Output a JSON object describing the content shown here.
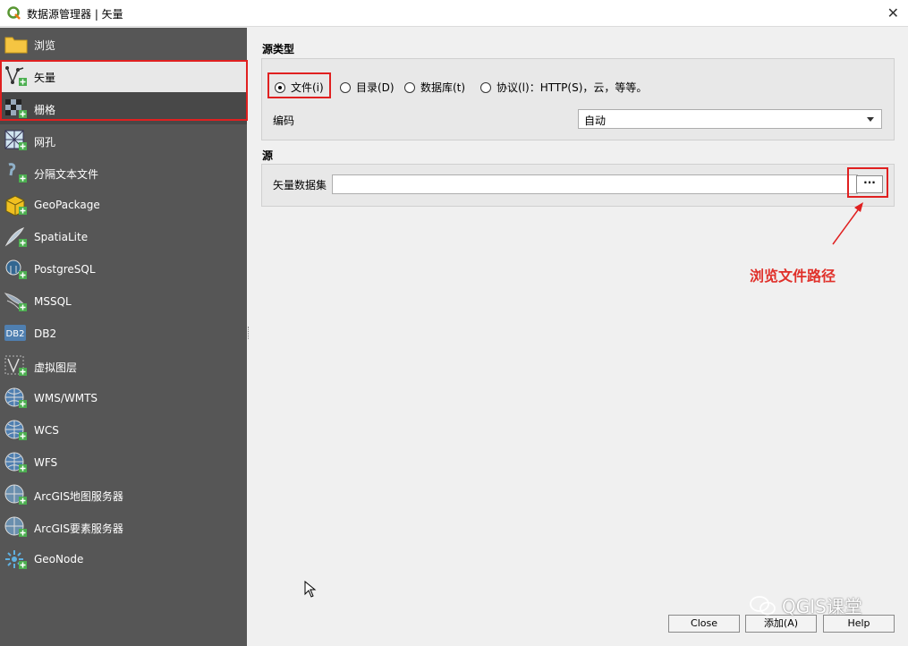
{
  "window": {
    "title": "数据源管理器 | 矢量"
  },
  "sidebar": {
    "items": [
      {
        "label": "浏览",
        "icon": "folder-icon"
      },
      {
        "label": "矢量",
        "icon": "vector-layer-icon"
      },
      {
        "label": "栅格",
        "icon": "raster-layer-icon"
      },
      {
        "label": "网孔",
        "icon": "mesh-layer-icon"
      },
      {
        "label": "分隔文本文件",
        "icon": "delimited-text-icon"
      },
      {
        "label": "GeoPackage",
        "icon": "geopackage-icon"
      },
      {
        "label": "SpatiaLite",
        "icon": "spatialite-icon"
      },
      {
        "label": "PostgreSQL",
        "icon": "postgresql-icon"
      },
      {
        "label": "MSSQL",
        "icon": "mssql-icon"
      },
      {
        "label": "DB2",
        "icon": "db2-icon"
      },
      {
        "label": "虚拟图层",
        "icon": "virtual-layer-icon"
      },
      {
        "label": "WMS/WMTS",
        "icon": "wms-globe-icon"
      },
      {
        "label": "WCS",
        "icon": "wcs-globe-icon"
      },
      {
        "label": "WFS",
        "icon": "wfs-globe-icon"
      },
      {
        "label": "ArcGIS地图服务器",
        "icon": "arcgis-map-server-icon"
      },
      {
        "label": "ArcGIS要素服务器",
        "icon": "arcgis-feature-server-icon"
      },
      {
        "label": "GeoNode",
        "icon": "geonode-icon"
      }
    ],
    "db2_icon_text": "DB2"
  },
  "source_type": {
    "title": "源类型",
    "options": [
      {
        "label": "文件(i)",
        "checked": true
      },
      {
        "label": "目录(D)",
        "checked": false
      },
      {
        "label": "数据库(t)",
        "checked": false
      },
      {
        "label": "协议(l)：HTTP(S)，云，等等。",
        "checked": false
      }
    ],
    "encoding_label": "编码",
    "encoding_value": "自动"
  },
  "source": {
    "title": "源",
    "dataset_label": "矢量数据集",
    "dataset_value": "",
    "browse_label": "···"
  },
  "annotation": {
    "text": "浏览文件路径",
    "color": "#e0302a"
  },
  "buttons": {
    "close": "Close",
    "add": "添加(A)",
    "help": "Help"
  },
  "watermark": {
    "text": "QGIS课堂"
  },
  "colors": {
    "sidebar_bg": "#565656",
    "selected_bg": "#e8e8e8",
    "highlight_red": "#e02020"
  }
}
